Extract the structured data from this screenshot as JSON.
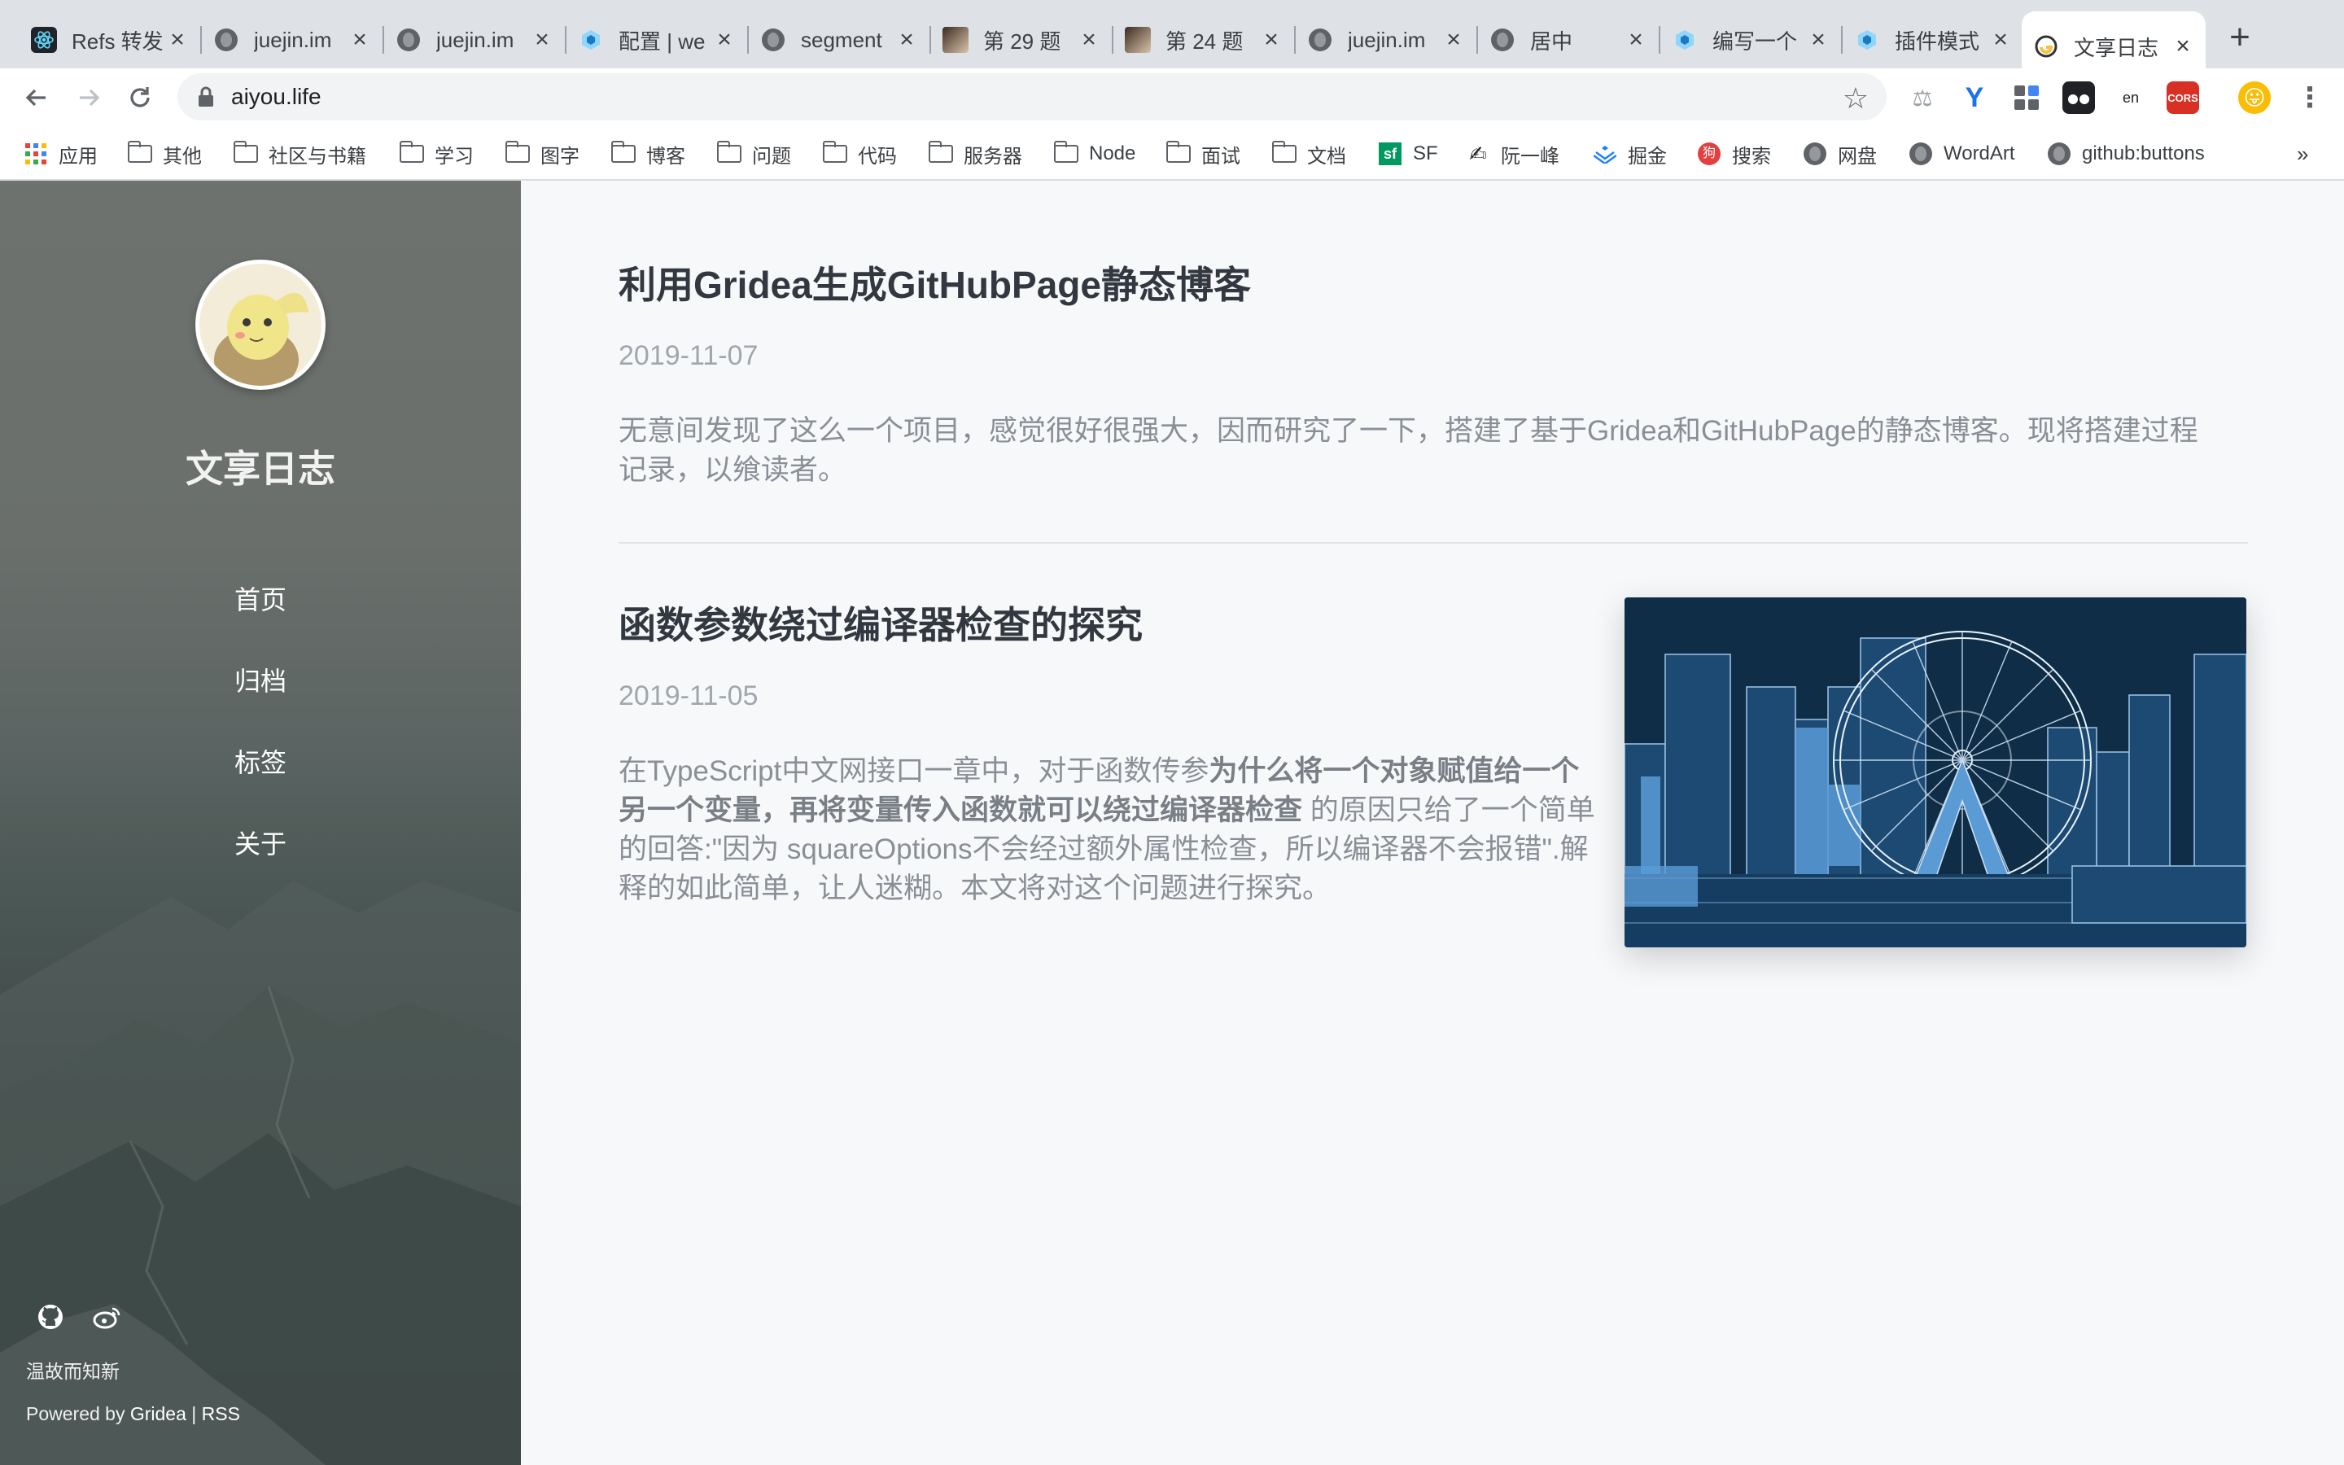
{
  "browser": {
    "tabs": [
      {
        "title": "Refs 转发",
        "icon": "react-icon"
      },
      {
        "title": "juejin.im",
        "icon": "globe-icon"
      },
      {
        "title": "juejin.im",
        "icon": "globe-icon"
      },
      {
        "title": "配置 | we",
        "icon": "webpack-icon"
      },
      {
        "title": "segment",
        "icon": "globe-icon"
      },
      {
        "title": "第 29 题",
        "icon": "avatar-icon"
      },
      {
        "title": "第 24 题",
        "icon": "avatar-icon"
      },
      {
        "title": "juejin.im",
        "icon": "globe-icon"
      },
      {
        "title": "居中",
        "icon": "globe-icon"
      },
      {
        "title": "编写一个",
        "icon": "webpack-icon"
      },
      {
        "title": "插件模式",
        "icon": "webpack-icon"
      },
      {
        "title": "文享日志",
        "icon": "gridea-icon",
        "active": true
      }
    ],
    "new_tab": "+",
    "url": "aiyou.life",
    "bookmarks": [
      {
        "label": "应用",
        "icon": "apps-grid-icon"
      },
      {
        "label": "其他",
        "icon": "folder-icon"
      },
      {
        "label": "社区与书籍",
        "icon": "folder-icon"
      },
      {
        "label": "学习",
        "icon": "folder-icon"
      },
      {
        "label": "图字",
        "icon": "folder-icon"
      },
      {
        "label": "博客",
        "icon": "folder-icon"
      },
      {
        "label": "问题",
        "icon": "folder-icon"
      },
      {
        "label": "代码",
        "icon": "folder-icon"
      },
      {
        "label": "服务器",
        "icon": "folder-icon"
      },
      {
        "label": "Node",
        "icon": "folder-icon"
      },
      {
        "label": "面试",
        "icon": "folder-icon"
      },
      {
        "label": "文档",
        "icon": "folder-icon"
      },
      {
        "label": "SF",
        "icon": "segmentfault-icon"
      },
      {
        "label": "阮一峰",
        "icon": "ruanyifeng-icon"
      },
      {
        "label": "掘金",
        "icon": "juejin-icon"
      },
      {
        "label": "搜索",
        "icon": "sogou-icon"
      },
      {
        "label": "网盘",
        "icon": "globe-icon"
      },
      {
        "label": "WordArt",
        "icon": "globe-icon"
      },
      {
        "label": "github:buttons",
        "icon": "globe-icon"
      }
    ],
    "bookmarks_overflow": "»",
    "ext_cors_label": "CORS",
    "ext_en_label": "en"
  },
  "site": {
    "name": "文享日志",
    "menu": [
      "首页",
      "归档",
      "标签",
      "关于"
    ],
    "motto": "温故而知新",
    "powered_prefix": "Powered by ",
    "powered_link": "Gridea",
    "powered_sep": " | ",
    "rss": "RSS"
  },
  "posts": [
    {
      "title": "利用Gridea生成GitHubPage静态博客",
      "date": "2019-11-07",
      "excerpt_line1": "无意间发现了这么一个项目，感觉很好很强大，因而研究了一下，搭建了基于Gridea和GitHubPage的静态博客。现将搭建过程",
      "excerpt_line2": "记录，以飨读者。"
    },
    {
      "title": "函数参数绕过编译器检查的探究",
      "date": "2019-11-05",
      "excerpt_a": "在TypeScript中文网接口一章中，对于函数传参",
      "excerpt_bold": "为什么将一个对象赋值给一个另一个变量，再将变量传入函数就可以绕过编译器检查",
      "excerpt_b": " 的原因只给了一个简单的回答:\"因为 squareOptions不会经过额外属性检查，所以编译器不会报错\".解释的如此简单，让人迷糊。本文将对这个问题进行探究。"
    }
  ],
  "colors": {
    "accent_blue": "#1a73e8",
    "sidebar_top": "#6e726e",
    "sidebar_bottom": "#2f3837",
    "page_bg": "#f7f8fa",
    "title_text": "#333840"
  }
}
